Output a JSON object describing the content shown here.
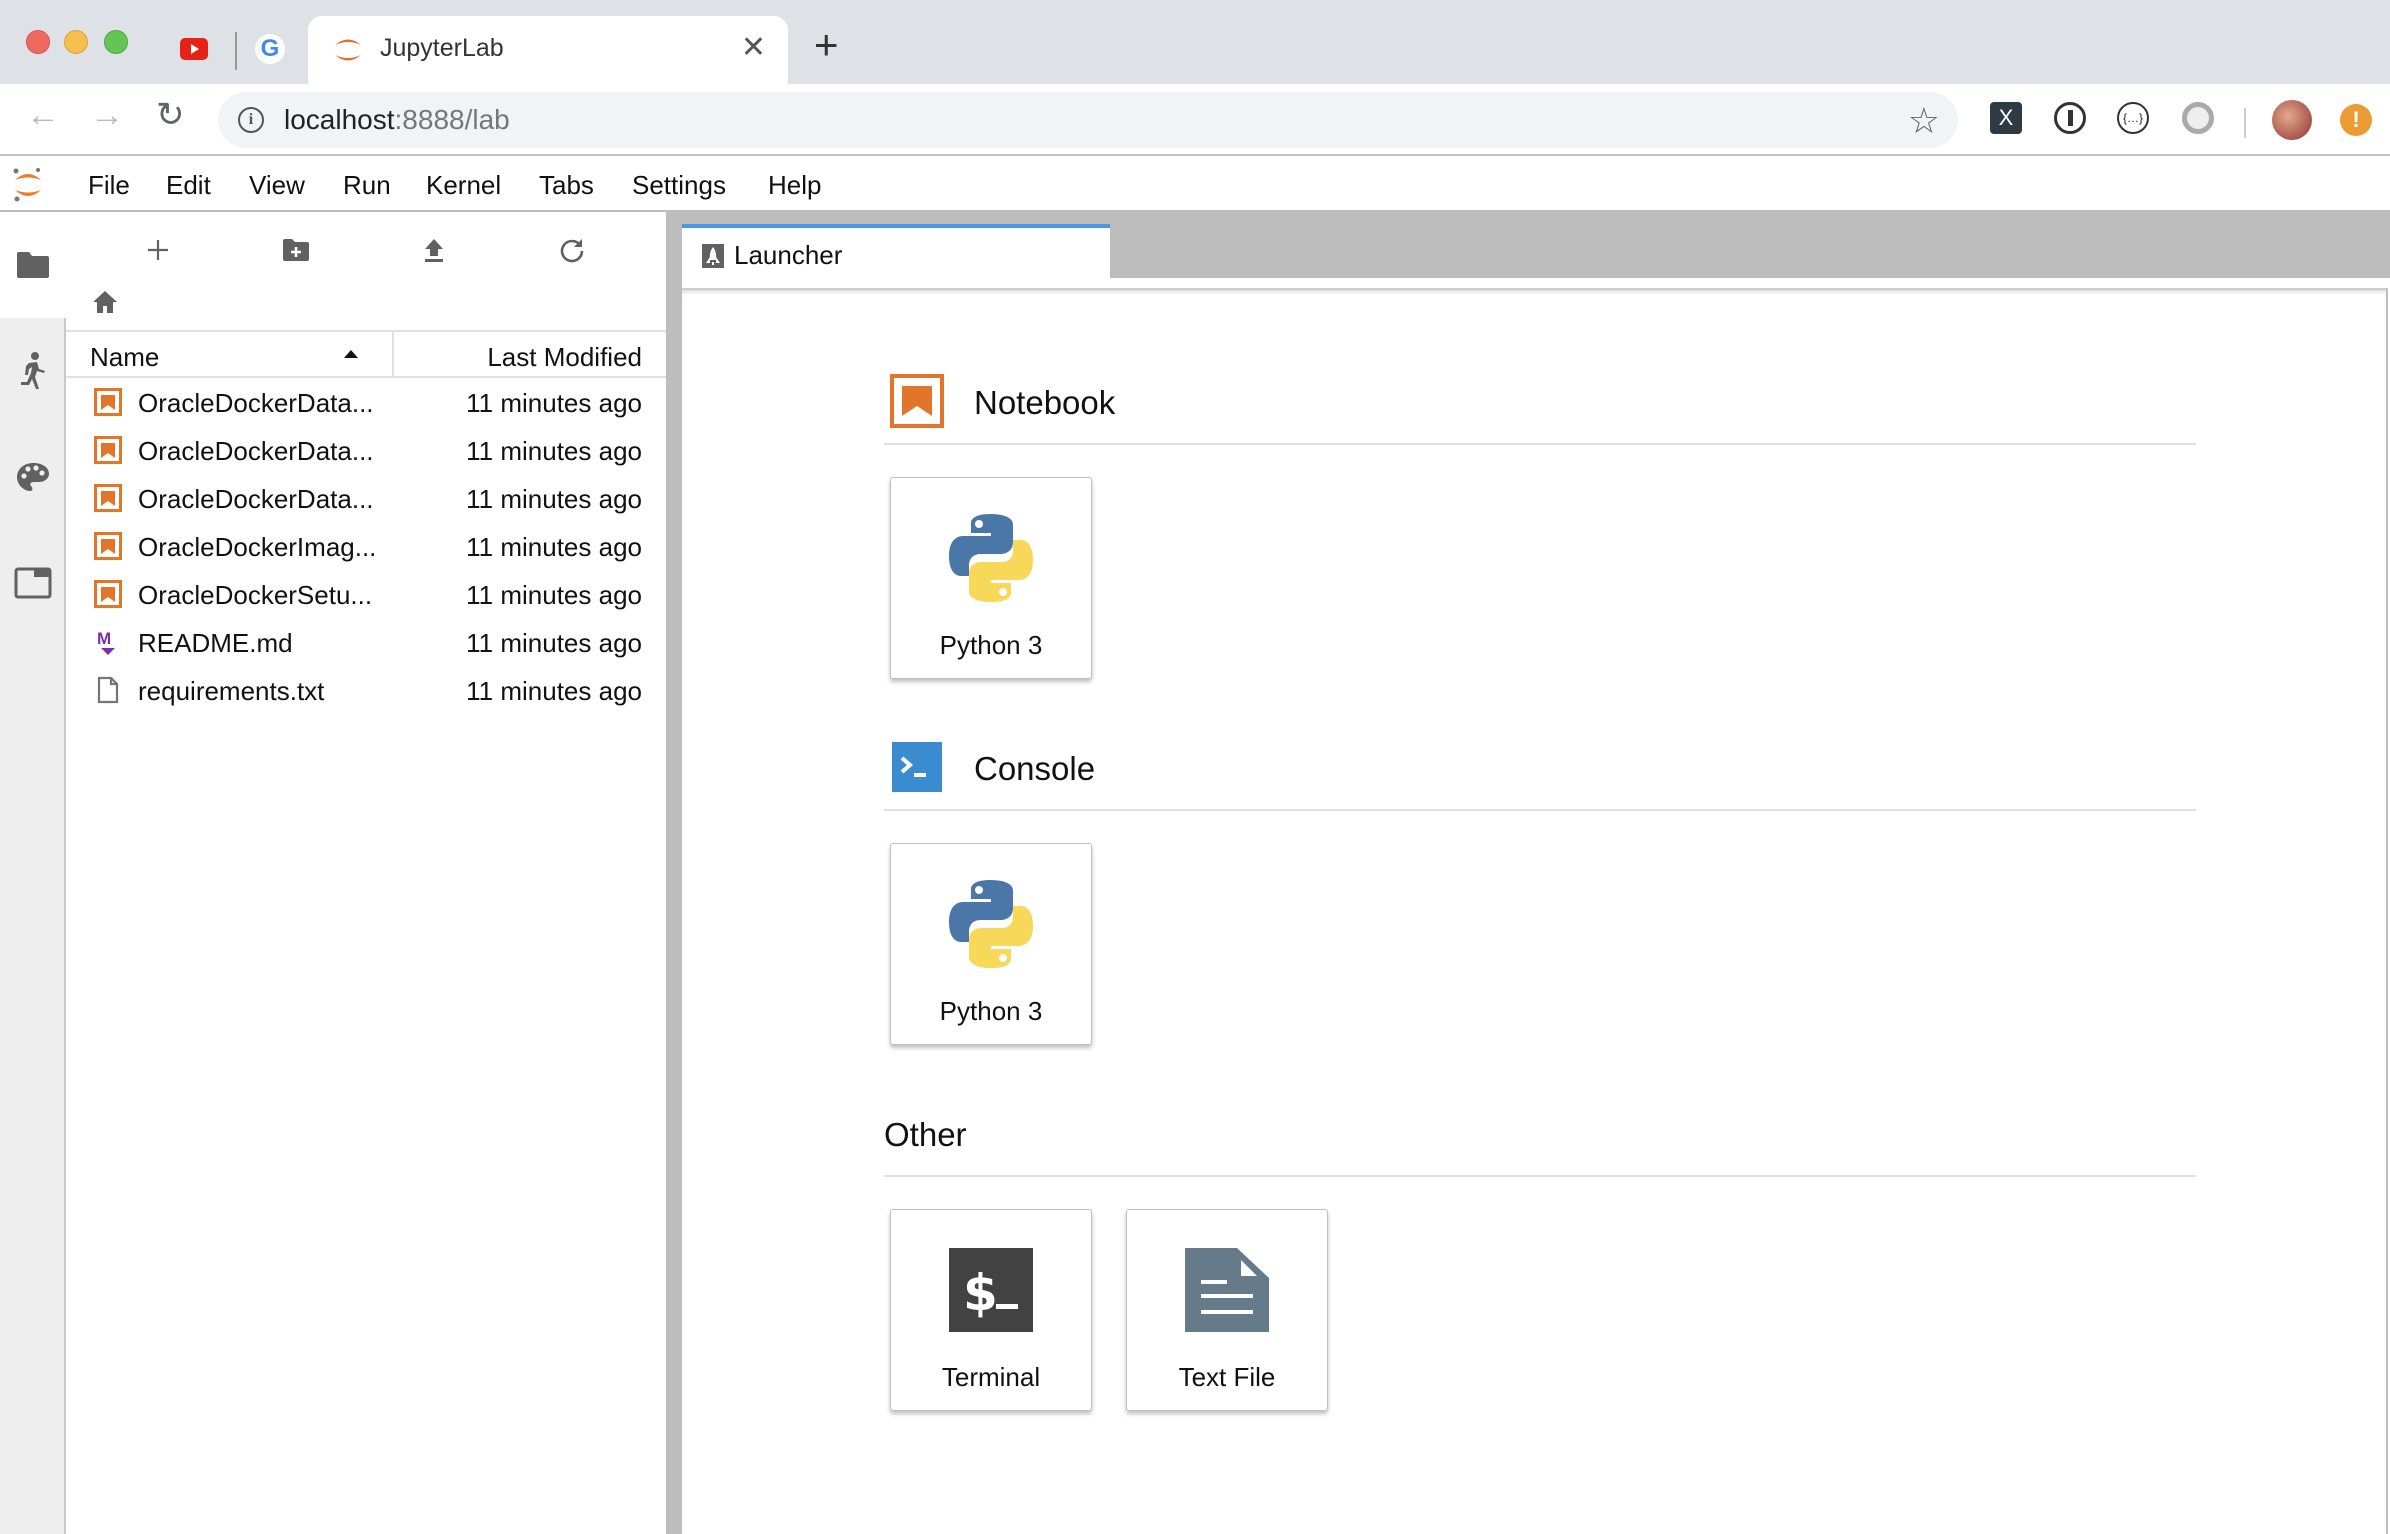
{
  "browser": {
    "tab_title": "JupyterLab",
    "new_tab_icon": "plus-icon",
    "url_host": "localhost",
    "url_rest": ":8888/lab",
    "extensions": [
      "x-extension-icon",
      "onepassword-icon",
      "json-viewer-icon",
      "ring-extension-icon"
    ],
    "alert_label": "!"
  },
  "menu": {
    "items": [
      "File",
      "Edit",
      "View",
      "Run",
      "Kernel",
      "Tabs",
      "Settings",
      "Help"
    ]
  },
  "filebrowser": {
    "columns": {
      "name": "Name",
      "modified": "Last Modified"
    },
    "files": [
      {
        "name": "OracleDockerData...",
        "type": "notebook",
        "modified": "11 minutes ago"
      },
      {
        "name": "OracleDockerData...",
        "type": "notebook",
        "modified": "11 minutes ago"
      },
      {
        "name": "OracleDockerData...",
        "type": "notebook",
        "modified": "11 minutes ago"
      },
      {
        "name": "OracleDockerImag...",
        "type": "notebook",
        "modified": "11 minutes ago"
      },
      {
        "name": "OracleDockerSetu...",
        "type": "notebook",
        "modified": "11 minutes ago"
      },
      {
        "name": "README.md",
        "type": "markdown",
        "modified": "11 minutes ago"
      },
      {
        "name": "requirements.txt",
        "type": "text",
        "modified": "11 minutes ago"
      }
    ]
  },
  "main": {
    "tab_label": "Launcher",
    "sections": {
      "notebook": {
        "title": "Notebook",
        "cards": [
          "Python 3"
        ]
      },
      "console": {
        "title": "Console",
        "cards": [
          "Python 3"
        ]
      },
      "other": {
        "title": "Other",
        "cards": [
          "Terminal",
          "Text File"
        ]
      }
    }
  },
  "colors": {
    "accent": "#4a98e4",
    "notebook_orange": "#e1762b",
    "console_blue": "#3b8bd1",
    "markdown_purple": "#7b2fa8"
  }
}
